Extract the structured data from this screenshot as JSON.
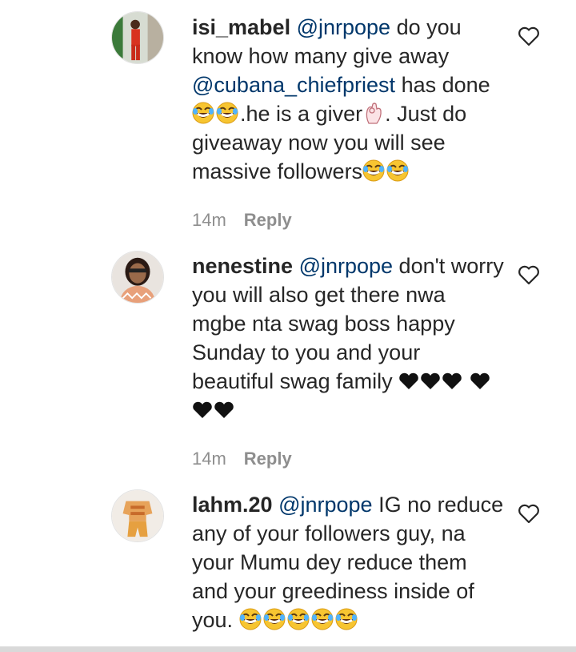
{
  "comments": [
    {
      "username": "isi_mabel",
      "mention": "@jnrpope",
      "text_a": " do you know how many give away ",
      "mention2": "@cubana_chiefpriest",
      "text_b": " has done",
      "text_c": ".he is a giver",
      "text_d": ". Just do giveaway now you will see massive followers",
      "time": "14m",
      "reply": "Reply"
    },
    {
      "username": "nenestine",
      "mention": "@jnrpope",
      "text_a": " don't worry you will also get there nwa mgbe nta swag boss happy Sunday to you and your beautiful swag family ",
      "time": "14m",
      "reply": "Reply"
    },
    {
      "username": "lahm.20",
      "mention": "@jnrpope",
      "text_a": " IG no reduce any of your followers guy, na your Mumu dey reduce them and your greediness inside of you. "
    }
  ],
  "icons": [
    "heart-outline-icon",
    "tears-of-joy-emoji",
    "heart-suit-emoji",
    "ok-hand-emoji"
  ],
  "colors": {
    "mention": "#00376b",
    "meta": "#8e8e8e",
    "text": "#262626"
  }
}
